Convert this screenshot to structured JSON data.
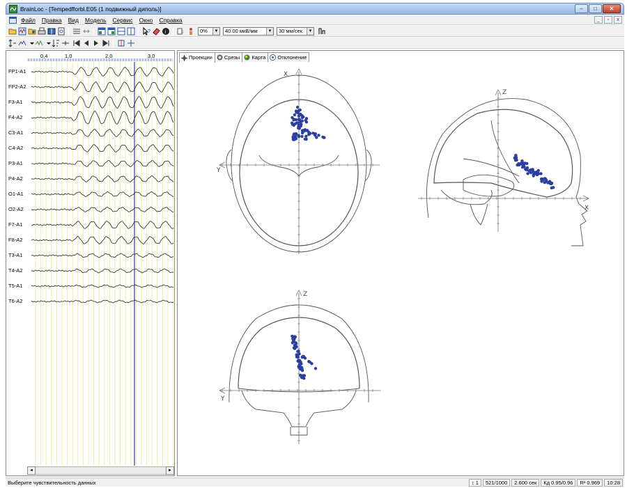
{
  "window": {
    "title": "BrainLoc - [Tempedfforbl.E05 (1 подвижный диполь)]",
    "min_glyph": "–",
    "max_glyph": "□",
    "close_glyph": "✕"
  },
  "menu": {
    "items": [
      "Файл",
      "Правка",
      "Вид",
      "Модель",
      "Сервис",
      "Окно",
      "Справка"
    ],
    "mdi_glyphs": [
      "_",
      "▫",
      "x"
    ]
  },
  "toolbar": {
    "percent": "0%",
    "sensitivity": "40.00 мкВ/мм",
    "speed": "30 мм/сек"
  },
  "eeg": {
    "time_ticks": [
      "0,4",
      "1,0",
      "2,0",
      "3,0"
    ],
    "channels": [
      "FP1-A1",
      "FP2-A2",
      "F3-A1",
      "F4-A2",
      "C3-A1",
      "C4-A2",
      "P3-A1",
      "P4-A2",
      "O1-A1",
      "O2-A2",
      "F7-A1",
      "F8-A2",
      "T3-A1",
      "T4-A2",
      "T5-A1",
      "T6-A2"
    ],
    "scroll_left": "◄",
    "scroll_right": "►"
  },
  "tabs": [
    {
      "label": "Проекции",
      "icon": "projection-icon",
      "active": true
    },
    {
      "label": "Срезы",
      "icon": "slices-icon",
      "active": false
    },
    {
      "label": "Карта",
      "icon": "map-icon",
      "active": false
    },
    {
      "label": "Отклонение",
      "icon": "deviation-icon",
      "active": false
    }
  ],
  "views": {
    "top_axes": {
      "vertical": "X",
      "horizontal": "Y"
    },
    "side_axes": {
      "vertical": "Z",
      "horizontal": "X"
    },
    "front_axes": {
      "vertical": "Z",
      "horizontal": "Y"
    }
  },
  "status": {
    "message": "Выберите чувствительность данных",
    "cells": [
      "1",
      "521/1000",
      "2.600 сек",
      "Кд 0.95/0.96",
      "R² 0.969",
      "10:28"
    ]
  },
  "colors": {
    "dipole": "#2b3fa0",
    "grid_line": "#f0eea0",
    "cursor": "#3a3aa0"
  }
}
